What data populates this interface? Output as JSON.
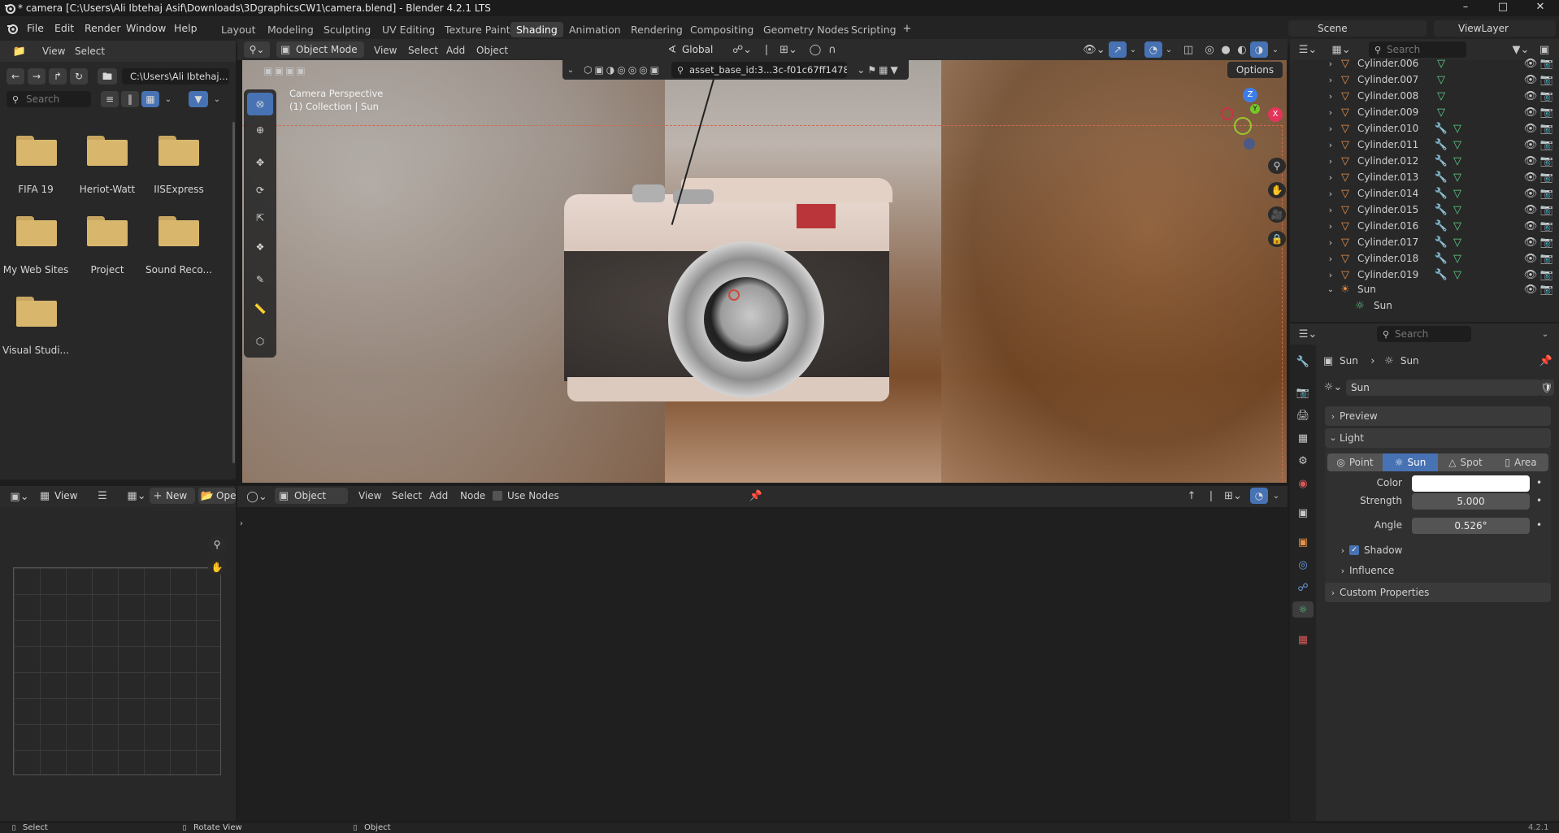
{
  "window": {
    "title": "* camera [C:\\Users\\Ali Ibtehaj Asif\\Downloads\\3DgraphicsCW1\\camera.blend] - Blender 4.2.1 LTS"
  },
  "menu": [
    "File",
    "Edit",
    "Render",
    "Window",
    "Help"
  ],
  "workspaces": [
    {
      "label": "Layout",
      "active": false
    },
    {
      "label": "Modeling",
      "active": false
    },
    {
      "label": "Sculpting",
      "active": false
    },
    {
      "label": "UV Editing",
      "active": false
    },
    {
      "label": "Texture Paint",
      "active": false
    },
    {
      "label": "Shading",
      "active": true
    },
    {
      "label": "Animation",
      "active": false
    },
    {
      "label": "Rendering",
      "active": false
    },
    {
      "label": "Compositing",
      "active": false
    },
    {
      "label": "Geometry Nodes",
      "active": false
    },
    {
      "label": "Scripting",
      "active": false
    }
  ],
  "scene": {
    "label": "Scene",
    "view_layer": "ViewLayer"
  },
  "file_browser": {
    "menu": [
      "View",
      "Select"
    ],
    "path": "C:\\Users\\Ali Ibtehaj...",
    "search_placeholder": "Search",
    "folders": [
      "FIFA 19",
      "Heriot-Watt",
      "IISExpress",
      "My Web Sites",
      "Project",
      "Sound Reco...",
      "Visual Studi..."
    ]
  },
  "viewport": {
    "mode": "Object Mode",
    "menu": [
      "View",
      "Select",
      "Add",
      "Object"
    ],
    "orientation": "Global",
    "asset_id": "asset_base_id:3...3c-f01c67ff1478",
    "options": "Options",
    "overlay_line1": "Camera Perspective",
    "overlay_line2": "(1) Collection | Sun",
    "gizmo": {
      "z": "Z",
      "y": "Y",
      "x": "X"
    }
  },
  "image_editor": {
    "view": "View",
    "new_label": "New",
    "open_label": "Ope"
  },
  "node_editor": {
    "type": "Object",
    "menu": [
      "View",
      "Select",
      "Add",
      "Node"
    ],
    "use_nodes": "Use Nodes"
  },
  "outliner": {
    "search_placeholder": "Search",
    "items": [
      {
        "name": "Cylinder.006",
        "mods": false
      },
      {
        "name": "Cylinder.007",
        "mods": false
      },
      {
        "name": "Cylinder.008",
        "mods": false
      },
      {
        "name": "Cylinder.009",
        "mods": false
      },
      {
        "name": "Cylinder.010",
        "mods": true
      },
      {
        "name": "Cylinder.011",
        "mods": true
      },
      {
        "name": "Cylinder.012",
        "mods": true
      },
      {
        "name": "Cylinder.013",
        "mods": true
      },
      {
        "name": "Cylinder.014",
        "mods": true
      },
      {
        "name": "Cylinder.015",
        "mods": true
      },
      {
        "name": "Cylinder.016",
        "mods": true
      },
      {
        "name": "Cylinder.017",
        "mods": true
      },
      {
        "name": "Cylinder.018",
        "mods": true
      },
      {
        "name": "Cylinder.019",
        "mods": true
      }
    ],
    "sun_object": "Sun",
    "sun_data": "Sun"
  },
  "properties": {
    "search_placeholder": "Search",
    "breadcrumb_object": "Sun",
    "breadcrumb_data": "Sun",
    "datablock": "Sun",
    "sections": {
      "preview": "Preview",
      "light": "Light",
      "shadow": "Shadow",
      "influence": "Influence",
      "custom": "Custom Properties"
    },
    "light_types": [
      "Point",
      "Sun",
      "Spot",
      "Area"
    ],
    "active_light_type": "Sun",
    "color_label": "Color",
    "color_value": "#ffffff",
    "strength_label": "Strength",
    "strength_value": "5.000",
    "angle_label": "Angle",
    "angle_value": "0.526°"
  },
  "statusbar": {
    "items": [
      "Select",
      "Rotate View",
      "Object"
    ],
    "version": "4.2.1"
  },
  "colors": {
    "accent": "#4772b3",
    "object_orange": "#e8914a",
    "mesh_green": "#5fd38d",
    "modifier_blue": "#6a9ee8"
  }
}
